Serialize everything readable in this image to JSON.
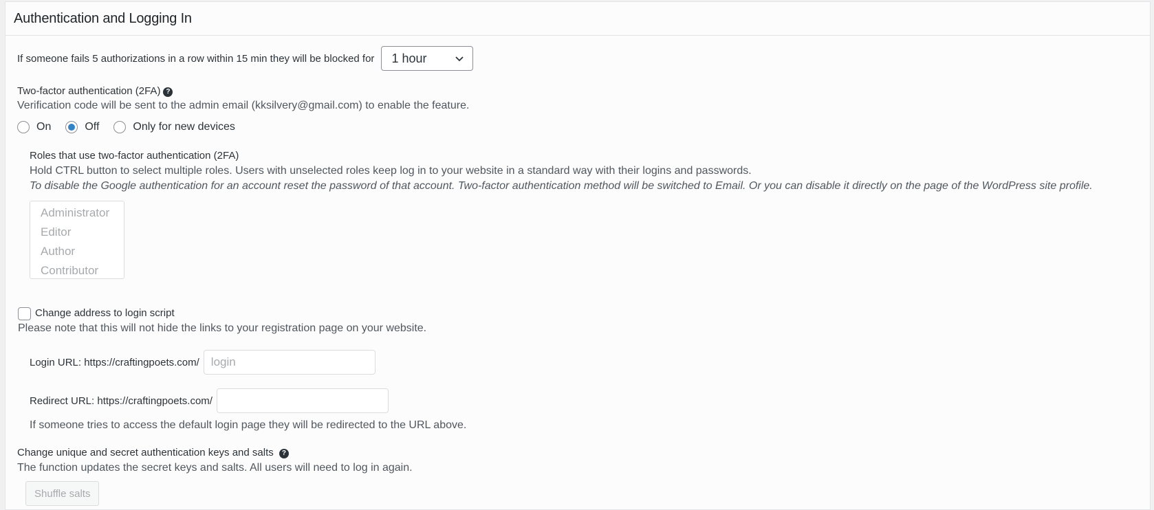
{
  "header": {
    "title": "Authentication and Logging In"
  },
  "lockout": {
    "label": "If someone fails 5 authorizations in a row within 15 min they will be blocked for",
    "selected": "1 hour"
  },
  "twofa": {
    "title": "Two-factor authentication (2FA)",
    "help_icon": "question-circle-icon",
    "description": "Verification code will be sent to the admin email (kksilvery@gmail.com) to enable the feature.",
    "options": [
      {
        "label": "On",
        "checked": false
      },
      {
        "label": "Off",
        "checked": true
      },
      {
        "label": "Only for new devices",
        "checked": false
      }
    ],
    "roles": {
      "title": "Roles that use two-factor authentication (2FA)",
      "hint": "Hold CTRL button to select multiple roles. Users with unselected roles keep log in to your website in a standard way with their logins and passwords.",
      "note": "To disable the Google authentication for an account reset the password of that account. Two-factor authentication method will be switched to Email. Or you can disable it directly on the page of the WordPress site profile.",
      "items": [
        "Administrator",
        "Editor",
        "Author",
        "Contributor"
      ]
    }
  },
  "login_script": {
    "checkbox_label": "Change address to login script",
    "checked": false,
    "note": "Please note that this will not hide the links to your registration page on your website.",
    "login_url_label": "Login URL: https://craftingpoets.com/",
    "login_url_value": "",
    "login_url_placeholder": "login",
    "redirect_url_label": "Redirect URL: https://craftingpoets.com/",
    "redirect_url_value": "",
    "redirect_note": "If someone tries to access the default login page they will be redirected to the URL above."
  },
  "salts": {
    "title": "Change unique and secret authentication keys and salts",
    "help_icon": "question-circle-icon",
    "description": "The function updates the secret keys and salts. All users will need to log in again.",
    "button_label": "Shuffle salts"
  }
}
